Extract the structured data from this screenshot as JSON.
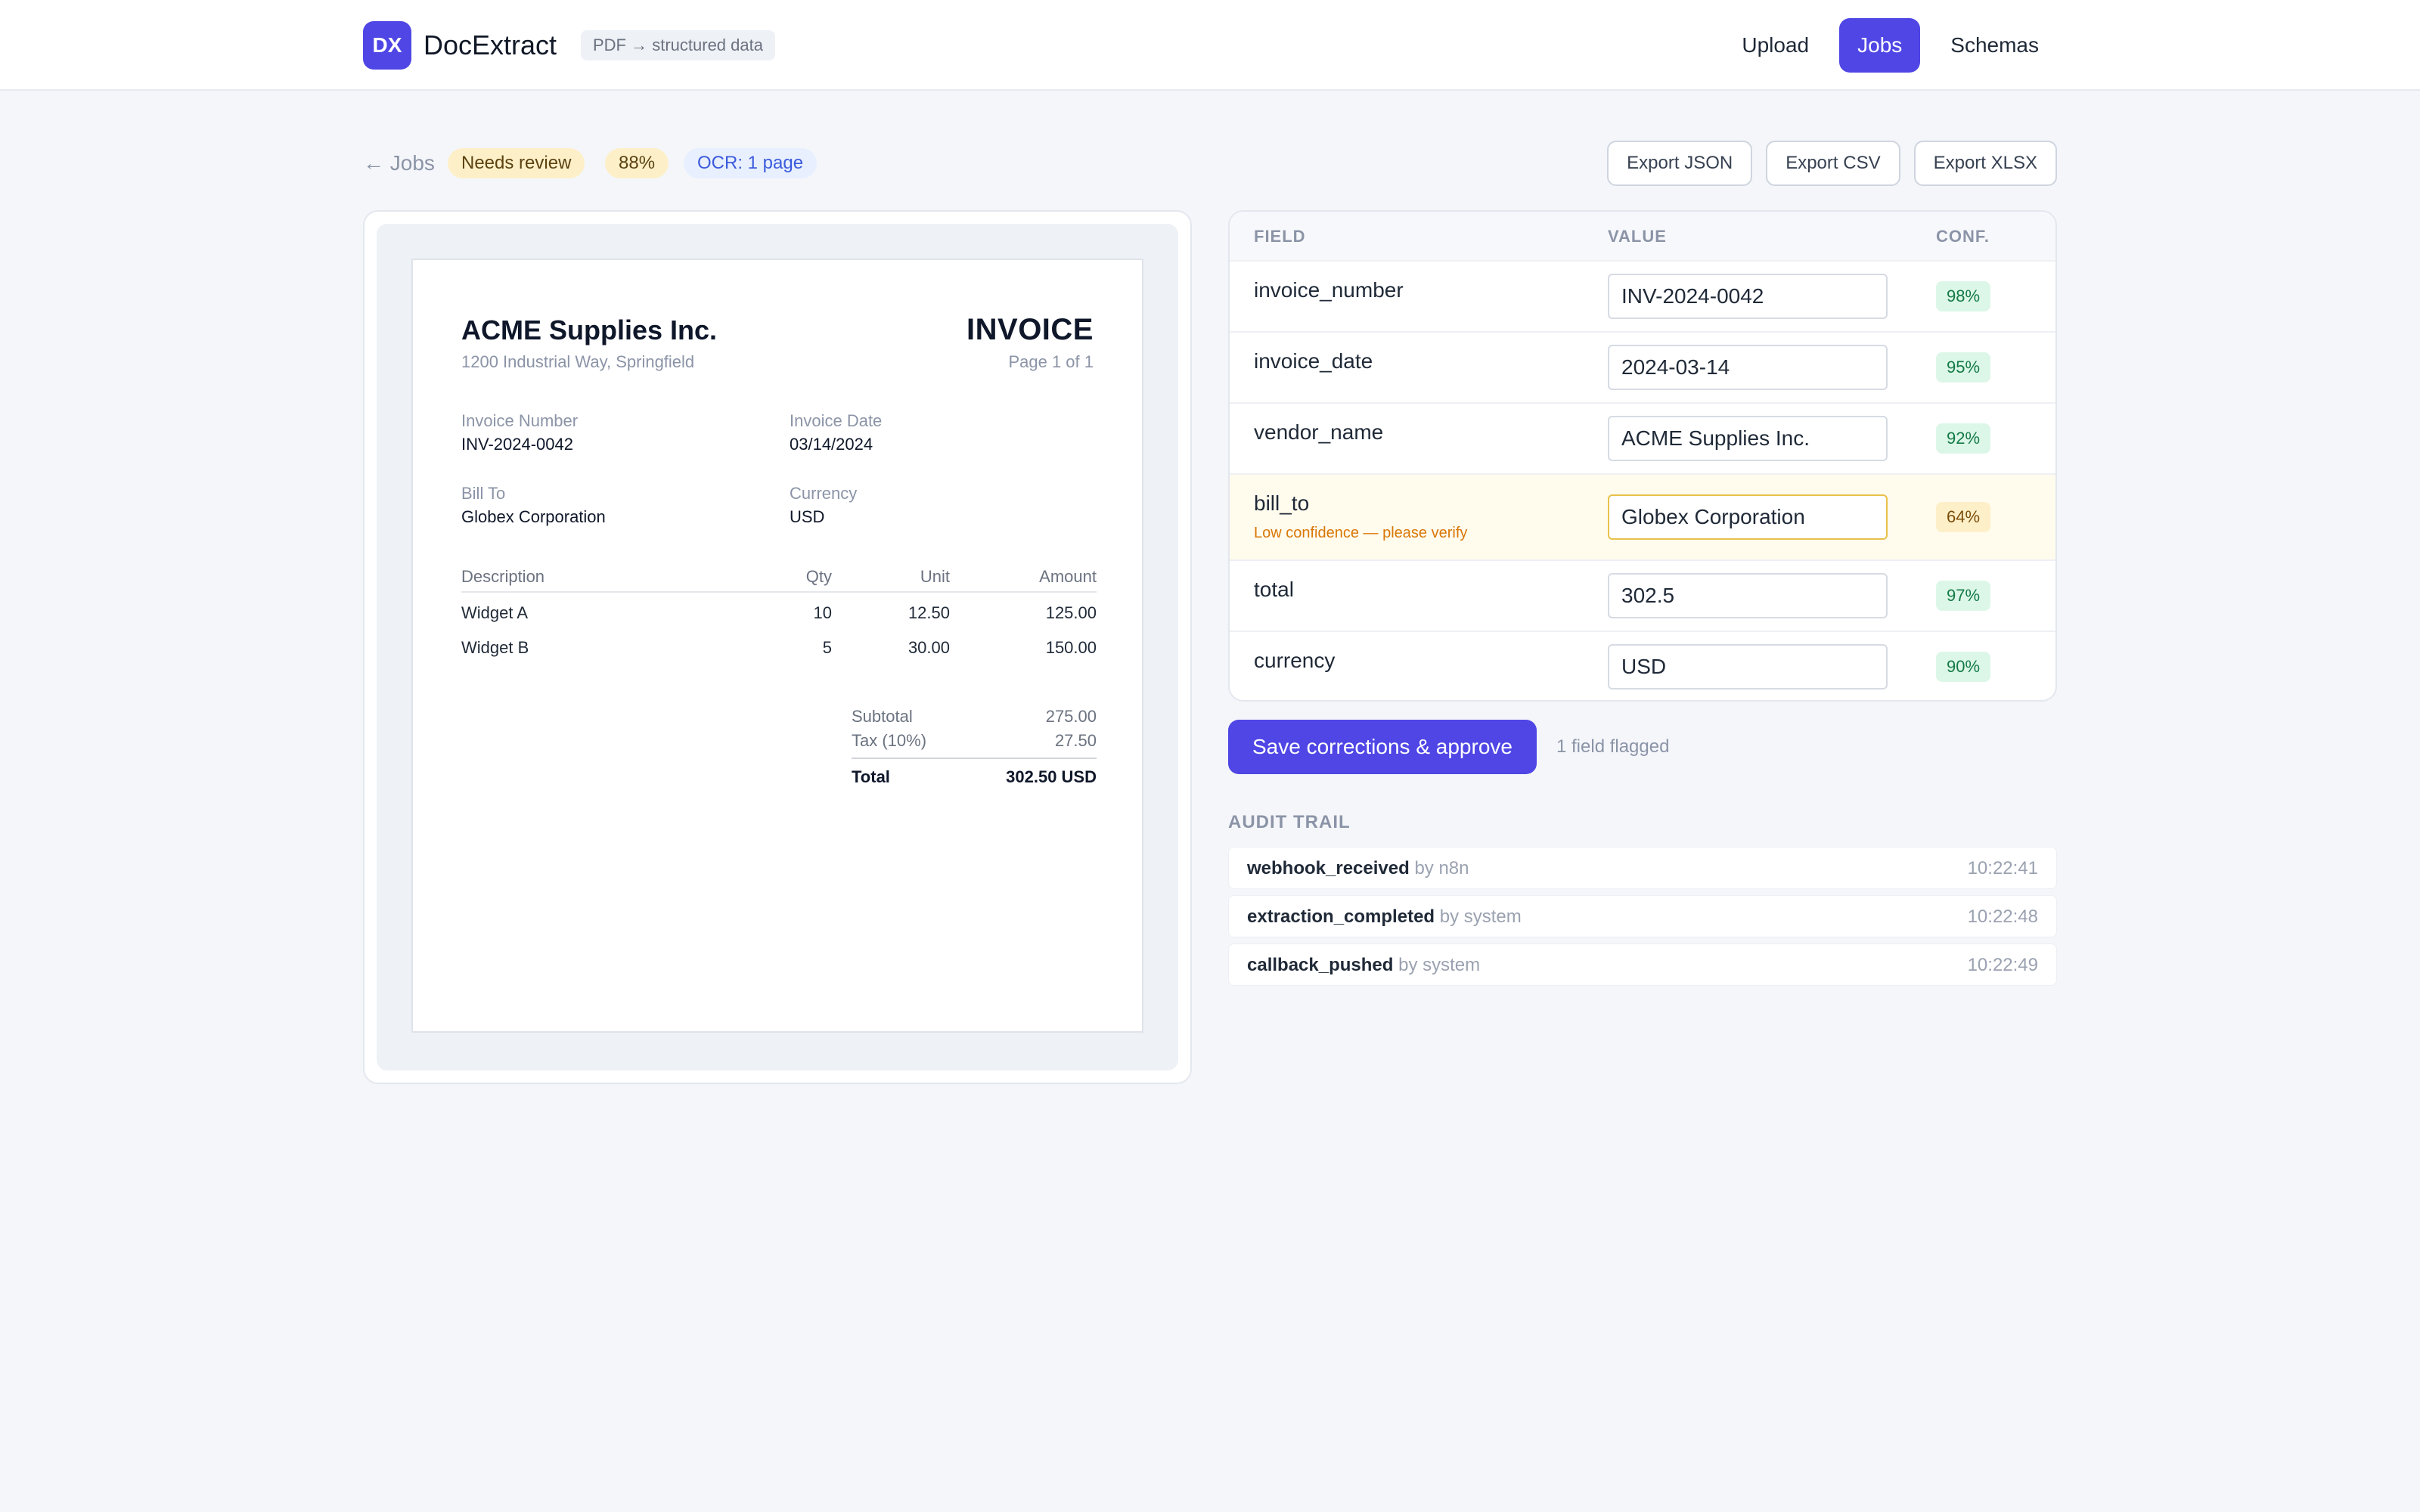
{
  "header": {
    "logo": "DX",
    "title": "DocExtract",
    "tagline": "PDF → structured data",
    "nav": [
      {
        "label": "Upload",
        "active": false
      },
      {
        "label": "Jobs",
        "active": true
      },
      {
        "label": "Schemas",
        "active": false
      }
    ]
  },
  "job": {
    "back_label": "← Jobs",
    "status": "Needs review",
    "confidence": "88%",
    "ocr": "OCR: 1 page",
    "exports": [
      "Export JSON",
      "Export CSV",
      "Export XLSX"
    ]
  },
  "document": {
    "company": "ACME Supplies Inc.",
    "address": "1200 Industrial Way, Springfield",
    "doc_title": "INVOICE",
    "page": "Page 1 of 1",
    "meta": {
      "invoice_number_label": "Invoice Number",
      "invoice_number": "INV-2024-0042",
      "invoice_date_label": "Invoice Date",
      "invoice_date": "03/14/2024",
      "bill_to_label": "Bill To",
      "bill_to": "Globex Corporation",
      "currency_label": "Currency",
      "currency": "USD"
    },
    "columns": [
      "Description",
      "Qty",
      "Unit",
      "Amount"
    ],
    "lines": [
      [
        "Widget A",
        "10",
        "12.50",
        "125.00"
      ],
      [
        "Widget B",
        "5",
        "30.00",
        "150.00"
      ]
    ],
    "totals": {
      "subtotal_label": "Subtotal",
      "subtotal": "275.00",
      "tax_label": "Tax (10%)",
      "tax": "27.50",
      "total_label": "Total",
      "total": "302.50 USD"
    }
  },
  "fields": {
    "headers": {
      "field": "FIELD",
      "value": "VALUE",
      "conf": "CONF."
    },
    "rows": [
      {
        "name": "invoice_number",
        "value": "INV-2024-0042",
        "conf": "98%",
        "level": "good"
      },
      {
        "name": "invoice_date",
        "value": "2024-03-14",
        "conf": "95%",
        "level": "good"
      },
      {
        "name": "vendor_name",
        "value": "ACME Supplies Inc.",
        "conf": "92%",
        "level": "good"
      },
      {
        "name": "bill_to",
        "value": "Globex Corporation",
        "conf": "64%",
        "level": "low",
        "warning": "Low confidence — please verify"
      },
      {
        "name": "total",
        "value": "302.5",
        "conf": "97%",
        "level": "good"
      },
      {
        "name": "currency",
        "value": "USD",
        "conf": "90%",
        "level": "good"
      }
    ],
    "colors": {
      "good_bg": "#dcf7e8",
      "low_bg": "#fdf0c8",
      "accent": "#4f46e5"
    }
  },
  "actions": {
    "save_label": "Save corrections & approve",
    "flagged_text": "1 field flagged"
  },
  "audit": {
    "title": "AUDIT TRAIL",
    "events": [
      {
        "event": "webhook_received",
        "by": "by n8n",
        "time": "10:22:41"
      },
      {
        "event": "extraction_completed",
        "by": "by system",
        "time": "10:22:48"
      },
      {
        "event": "callback_pushed",
        "by": "by system",
        "time": "10:22:49"
      }
    ]
  }
}
